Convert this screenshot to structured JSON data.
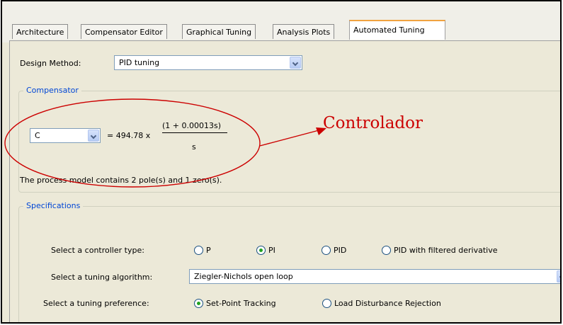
{
  "tabs": [
    {
      "label": "Architecture"
    },
    {
      "label": "Compensator Editor"
    },
    {
      "label": "Graphical Tuning"
    },
    {
      "label": "Analysis Plots"
    },
    {
      "label": "Automated Tuning",
      "active": true
    }
  ],
  "design_method": {
    "label": "Design Method:",
    "value": "PID tuning"
  },
  "compensator": {
    "title": "Compensator",
    "selector_value": "C",
    "gain_text": "= 494.78 x",
    "numerator": "(1 + 0.00013s)",
    "denominator": "s",
    "model_text": "The process model contains 2 pole(s) and 1 zero(s)."
  },
  "annotation": {
    "text": "Controlador",
    "color": "#cc0000"
  },
  "specifications": {
    "title": "Specifications",
    "controller_type": {
      "label": "Select a controller type:",
      "options": [
        {
          "label": "P",
          "selected": false
        },
        {
          "label": "PI",
          "selected": true
        },
        {
          "label": "PID",
          "selected": false
        },
        {
          "label": "PID with filtered derivative",
          "selected": false
        }
      ]
    },
    "tuning_algorithm": {
      "label": "Select a tuning algorithm:",
      "value": "Ziegler-Nichols open loop"
    },
    "tuning_preference": {
      "label": "Select a tuning preference:",
      "options": [
        {
          "label": "Set-Point Tracking",
          "selected": true
        },
        {
          "label": "Load Disturbance Rejection",
          "selected": false
        }
      ]
    }
  },
  "colors": {
    "accent_tab": "#f1a340",
    "group_title": "#0046d5",
    "radio_on": "#21a121"
  }
}
